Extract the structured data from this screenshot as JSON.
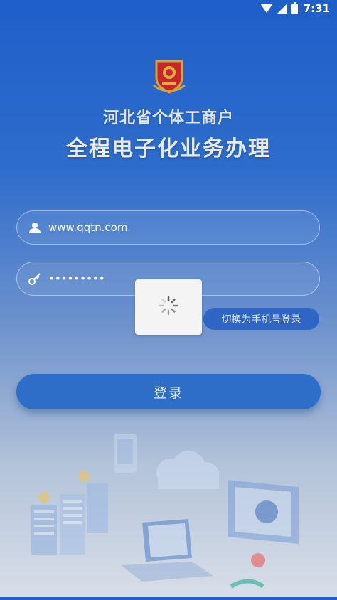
{
  "status_bar": {
    "time": "7:31",
    "icons": [
      "wifi-icon",
      "cell-signal-icon",
      "battery-icon"
    ]
  },
  "header": {
    "emblem": "national-emblem-badge",
    "title_line1": "河北省个体工商户",
    "title_line2": "全程电子化业务办理"
  },
  "form": {
    "username_value": "www.qqtn.com",
    "password_value": "•••••••••",
    "username_icon": "user-icon",
    "password_icon": "key-icon",
    "switch_label": "切换为手机号登录",
    "login_label": "登录"
  },
  "overlay": {
    "loading_dialog": "spinner-icon"
  },
  "colors": {
    "primary": "#2e6ec9",
    "background_top": "#1f5fc9",
    "background_bottom": "#d8dee8"
  }
}
